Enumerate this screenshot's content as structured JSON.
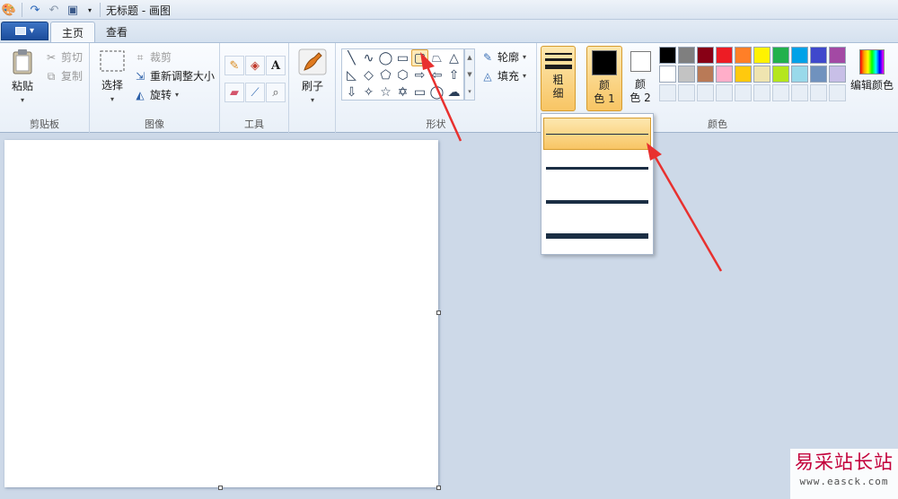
{
  "window": {
    "title": "无标题 - 画图"
  },
  "quick_access": {
    "icons": [
      "paint-app-icon",
      "redo-icon",
      "undo-icon",
      "save-icon",
      "customize-dropdown-icon"
    ]
  },
  "tabs": [
    {
      "label": "主页",
      "active": true
    },
    {
      "label": "查看",
      "active": false
    }
  ],
  "ribbon": {
    "clipboard": {
      "label": "剪贴板",
      "paste": "粘贴",
      "cut": "剪切",
      "copy": "复制"
    },
    "image": {
      "label": "图像",
      "select": "选择",
      "crop": "裁剪",
      "resize": "重新调整大小",
      "rotate": "旋转"
    },
    "tools": {
      "label": "工具",
      "icons": [
        "pencil-icon",
        "fill-bucket-icon",
        "text-icon",
        "eraser-icon",
        "color-picker-icon",
        "magnifier-icon"
      ]
    },
    "brushes": {
      "label": "刷子"
    },
    "shapes": {
      "label": "形状",
      "outline": "轮廓",
      "fill": "填充",
      "selected_shape": "rounded-rectangle"
    },
    "size": {
      "label_line1": "粗",
      "label_line2": "细"
    },
    "colors": {
      "label": "颜色",
      "color1": {
        "label_line1": "颜",
        "label_line2": "色 1",
        "value": "#000000"
      },
      "color2": {
        "label_line1": "颜",
        "label_line2": "色 2",
        "value": "#ffffff"
      },
      "edit_colors": "编辑颜色",
      "palette_row1": [
        "#000000",
        "#7f7f7f",
        "#880015",
        "#ed1c24",
        "#ff7f27",
        "#fff200",
        "#22b14c",
        "#00a2e8",
        "#3f48cc",
        "#a349a4"
      ],
      "palette_row2": [
        "#ffffff",
        "#c3c3c3",
        "#b97a57",
        "#ffaec9",
        "#ffc90e",
        "#efe4b0",
        "#b5e61d",
        "#99d9ea",
        "#7092be",
        "#c8bfe7"
      ]
    }
  },
  "size_dropdown": {
    "options": [
      "1px",
      "3px",
      "5px",
      "8px"
    ],
    "selected_index": 0
  },
  "annotation": {
    "color": "#e8312f"
  },
  "watermark": {
    "title": "易采站长站",
    "url": "www.easck.com"
  }
}
